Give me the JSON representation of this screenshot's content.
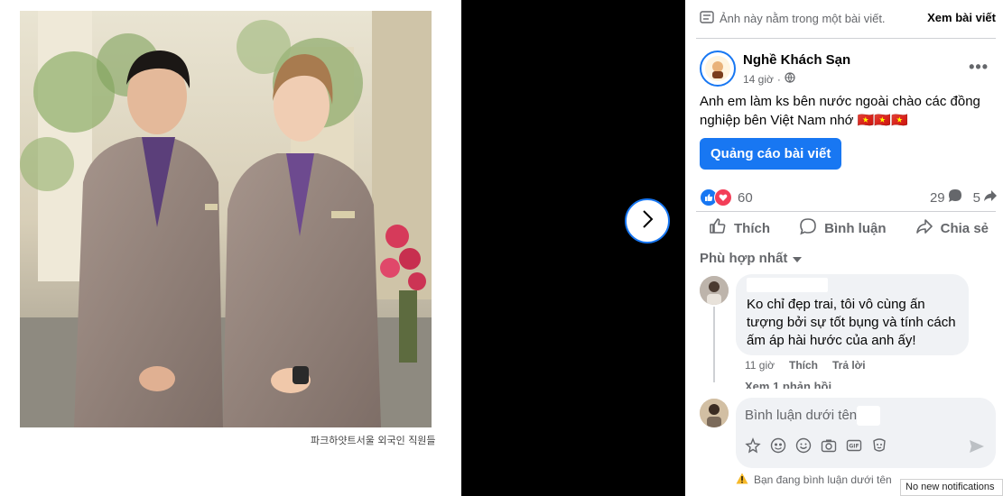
{
  "photo": {
    "caption": "파크하얏트서울 외국인 직원들"
  },
  "viewer": {
    "next_icon": "chevron-right-icon"
  },
  "post": {
    "notice_text": "Ảnh này nằm trong một bài viết.",
    "view_post_label": "Xem bài viết",
    "page_name": "Nghề Khách Sạn",
    "time": "14 giờ",
    "text": "Anh em làm ks bên nước ngoài chào các đồng nghiệp bên Việt Nam nhớ 🇻🇳🇻🇳🇻🇳",
    "boost_label": "Quảng cáo bài viết",
    "reaction_count": "60",
    "comment_count": "29",
    "share_count": "5",
    "actions": {
      "like": "Thích",
      "comment": "Bình luận",
      "share": "Chia sẻ"
    },
    "sort_label": "Phù hợp nhất"
  },
  "comment": {
    "text": "Ko chỉ đẹp trai, tôi vô cùng ấn tượng bởi sự tốt bụng và tính cách ấm áp hài hước của anh ấy!",
    "time": "11 giờ",
    "like_label": "Thích",
    "reply_label": "Trả lời",
    "view_replies": "Xem 1 phản hồi"
  },
  "composer": {
    "placeholder": "Bình luận dưới tên",
    "warning": "Bạn đang bình luận dưới tên"
  },
  "system": {
    "toast": "No new notifications"
  },
  "colors": {
    "accent": "#1877f2",
    "love": "#f33e58"
  }
}
